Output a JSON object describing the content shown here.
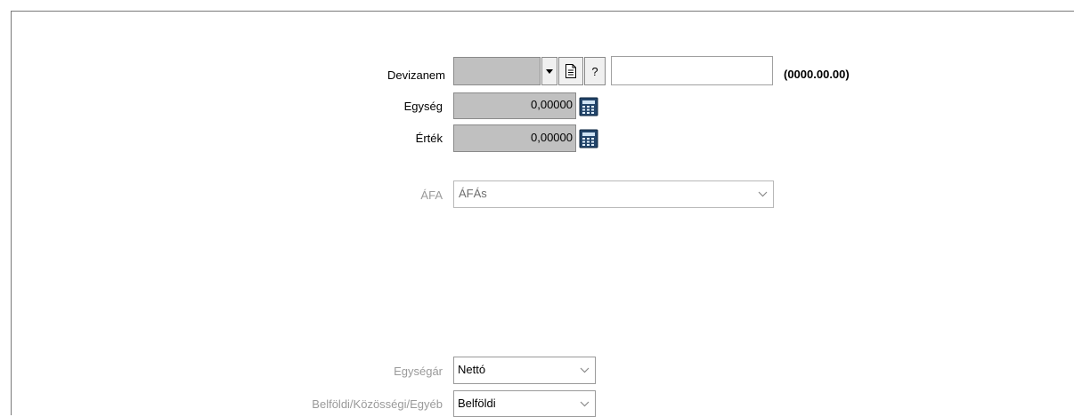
{
  "form": {
    "devizanem": {
      "label": "Devizanem",
      "code_value": "",
      "name_value": "",
      "date_format": "(0000.00.00)",
      "help_label": "?"
    },
    "egyseg": {
      "label": "Egység",
      "value": "0,00000"
    },
    "ertek": {
      "label": "Érték",
      "value": "0,00000"
    },
    "afa": {
      "label": "ÁFA",
      "value": "ÁFÁs"
    },
    "egysegar": {
      "label": "Egységár",
      "value": "Nettó"
    },
    "belfoldi": {
      "label": "Belföldi/Közösségi/Egyéb",
      "value": "Belföldi"
    }
  },
  "icons": {
    "dropdown": "dropdown-arrow-icon",
    "document": "document-icon",
    "calculator": "calculator-icon",
    "chevron": "chevron-down-icon"
  },
  "colors": {
    "readonly_field": "#c0c0c0",
    "disabled_text": "#9a9a9a"
  }
}
